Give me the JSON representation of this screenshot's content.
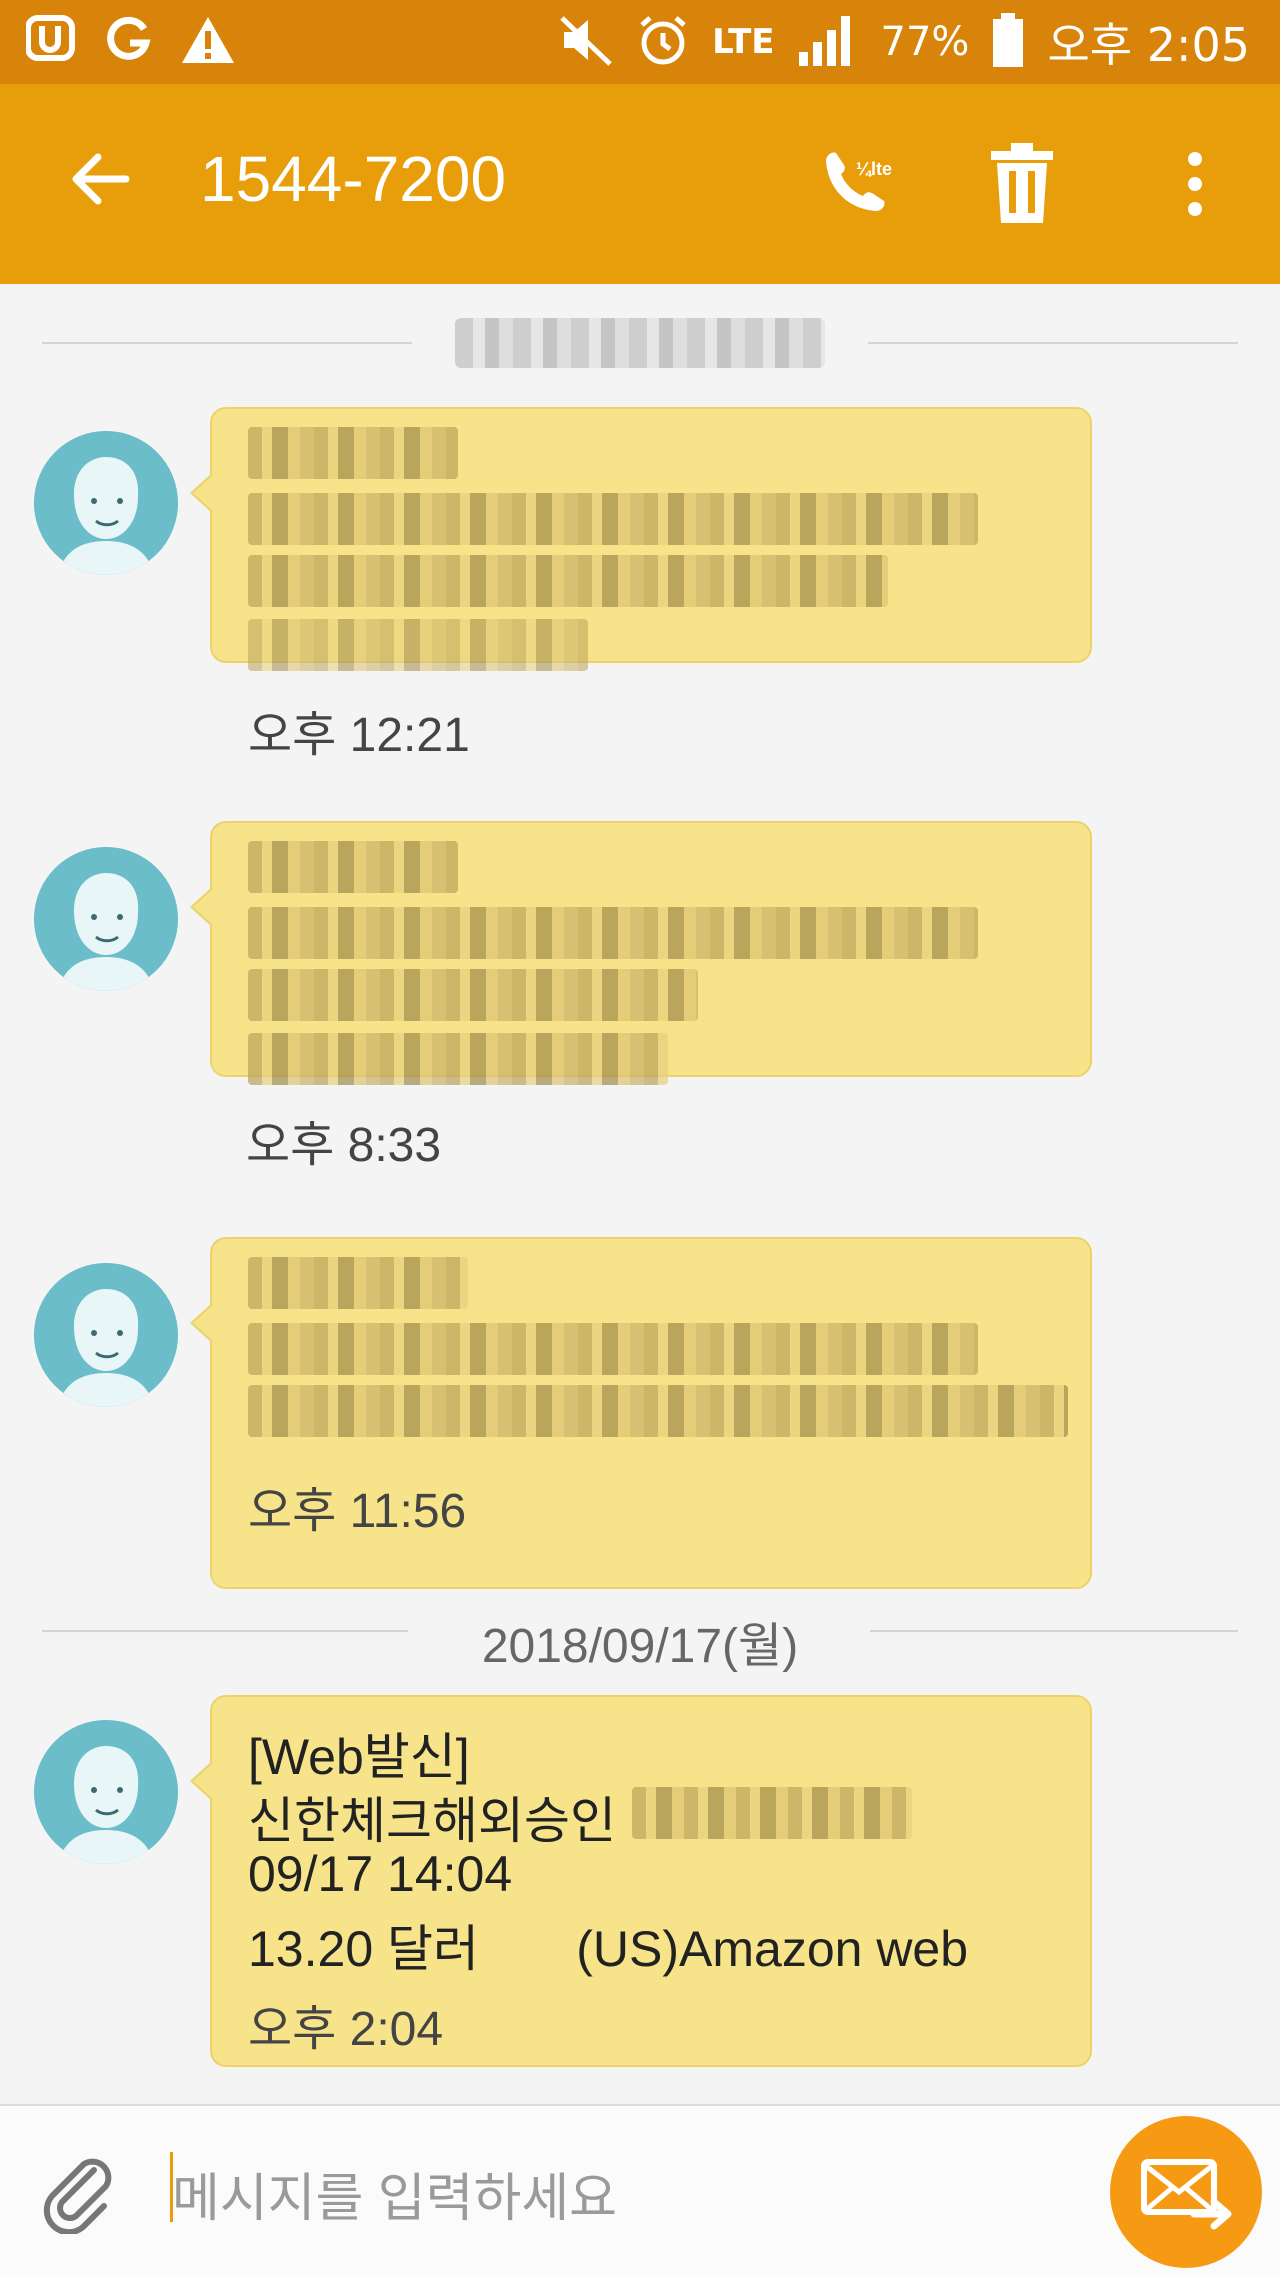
{
  "status_bar": {
    "network_label": "LTE",
    "battery": "77%",
    "time": "오후 2:05"
  },
  "toolbar": {
    "title": "1544-7200",
    "call_icon_label": "¼lte"
  },
  "thread": {
    "date_separators": [
      {
        "label": ""
      },
      {
        "label": "2018/09/17(월)"
      }
    ],
    "messages": [
      {
        "time": "오후 12:21",
        "text_lines": []
      },
      {
        "time": "오후 8:33",
        "text_lines": []
      },
      {
        "time": "오후 11:56",
        "text_lines": []
      },
      {
        "time": "오후 2:04",
        "text_lines": [
          "[Web발신]",
          "신한체크해외승인",
          "09/17 14:04",
          "13.20 달러       (US)Amazon web"
        ]
      }
    ]
  },
  "composer": {
    "placeholder": "메시지를 입력하세요"
  },
  "icons": {
    "status": [
      "u-plus-icon",
      "g-icon",
      "warning-icon",
      "mute-icon",
      "alarm-icon",
      "signal-icon",
      "battery-icon"
    ],
    "toolbar": [
      "back-arrow-icon",
      "volte-call-icon",
      "trash-icon",
      "more-vert-icon"
    ],
    "composer": [
      "paperclip-icon",
      "send-message-icon"
    ]
  },
  "colors": {
    "status_bar": "#d8840a",
    "toolbar": "#e89e0a",
    "bubble": "#f7e48a",
    "avatar": "#6bbec9",
    "send_button": "#f59a12"
  }
}
